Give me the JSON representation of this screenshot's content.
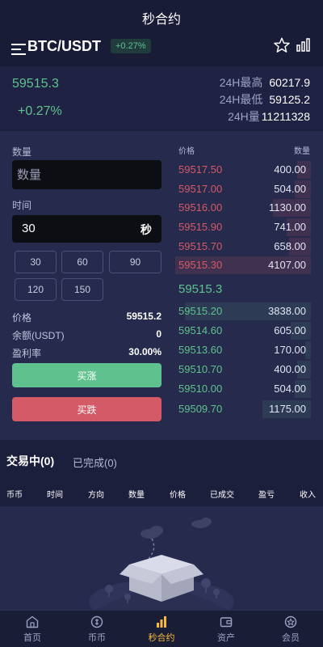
{
  "header": {
    "title": "秒合约"
  },
  "symbol": {
    "name": "BTC/USDT",
    "change": "+0.27%"
  },
  "ticker": {
    "last_price": "59515.3",
    "change_pct": "+0.27%",
    "high_label": "24H最高",
    "high_value": "60217.9",
    "low_label": "24H最低",
    "low_value": "59125.2",
    "vol_label": "24H量",
    "vol_value": "11211328"
  },
  "form": {
    "qty_label": "数量",
    "qty_placeholder": "数量",
    "time_label": "时间",
    "time_value": "30",
    "time_unit": "秒",
    "time_options": [
      "30",
      "60",
      "90",
      "120",
      "150"
    ],
    "price_label": "价格",
    "price_value": "59515.2",
    "balance_label": "余额(USDT)",
    "balance_value": "0",
    "profit_label": "盈利率",
    "profit_value": "30.00%",
    "buy_up_label": "买涨",
    "buy_down_label": "买跌"
  },
  "orderbook": {
    "price_header": "价格",
    "qty_header": "数量",
    "asks": [
      {
        "price": "59517.50",
        "qty": "400.00",
        "depth": 0.1
      },
      {
        "price": "59517.00",
        "qty": "504.00",
        "depth": 0.12
      },
      {
        "price": "59516.00",
        "qty": "1130.00",
        "depth": 0.28
      },
      {
        "price": "59515.90",
        "qty": "741.00",
        "depth": 0.18
      },
      {
        "price": "59515.70",
        "qty": "658.00",
        "depth": 0.16
      },
      {
        "price": "59515.30",
        "qty": "4107.00",
        "depth": 1.0
      }
    ],
    "mid_price": "59515.3",
    "bids": [
      {
        "price": "59515.20",
        "qty": "3838.00",
        "depth": 0.93
      },
      {
        "price": "59514.60",
        "qty": "605.00",
        "depth": 0.15
      },
      {
        "price": "59513.60",
        "qty": "170.00",
        "depth": 0.04
      },
      {
        "price": "59510.70",
        "qty": "400.00",
        "depth": 0.1
      },
      {
        "price": "59510.00",
        "qty": "504.00",
        "depth": 0.12
      },
      {
        "price": "59509.70",
        "qty": "1175.00",
        "depth": 0.36
      }
    ]
  },
  "orders": {
    "tab_active": "交易中(0)",
    "tab_done": "已完成(0)",
    "columns": [
      "币币",
      "时间",
      "方向",
      "数量",
      "价格",
      "已成交",
      "盈亏",
      "收入"
    ]
  },
  "nav": {
    "items": [
      {
        "label": "首页",
        "icon": "home-icon"
      },
      {
        "label": "币币",
        "icon": "coin-icon"
      },
      {
        "label": "秒合约",
        "icon": "bars-icon"
      },
      {
        "label": "资产",
        "icon": "wallet-icon"
      },
      {
        "label": "会员",
        "icon": "member-icon"
      }
    ],
    "active": "秒合约"
  },
  "colors": {
    "up": "#5fc28e",
    "down": "#d35a66",
    "accent": "#f6b93b",
    "background": "#1c1f3c",
    "panel": "#262a4d"
  }
}
